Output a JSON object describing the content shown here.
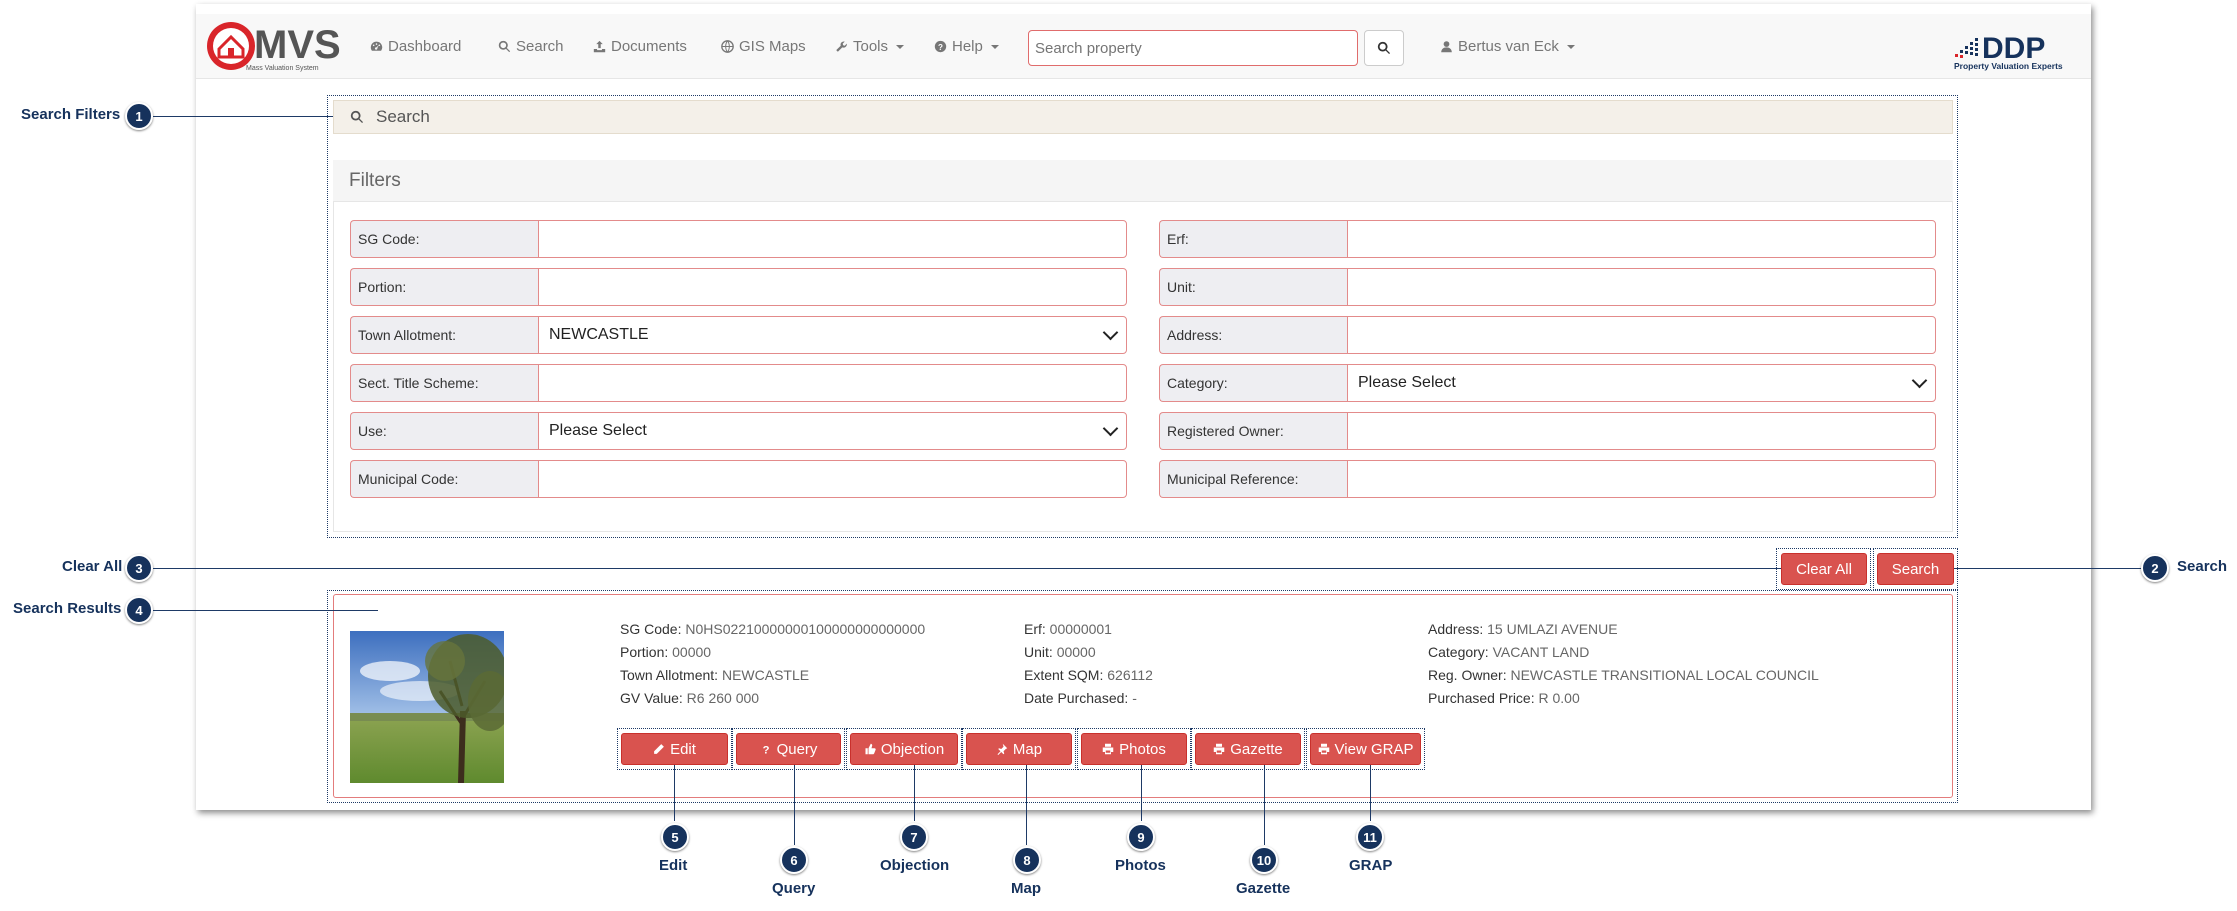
{
  "navbar": {
    "logo_text": "MVS",
    "logo_sub": "Mass Valuation System",
    "items": [
      {
        "label": "Dashboard",
        "icon": "dashboard-icon"
      },
      {
        "label": "Search",
        "icon": "search-icon"
      },
      {
        "label": "Documents",
        "icon": "upload-icon"
      },
      {
        "label": "GIS Maps",
        "icon": "globe-icon"
      },
      {
        "label": "Tools",
        "icon": "wrench-icon"
      },
      {
        "label": "Help",
        "icon": "question-icon"
      }
    ],
    "search_placeholder": "Search property",
    "user": "Bertus van Eck",
    "brand": "DDP",
    "brand_sub": "Property Valuation Experts"
  },
  "search_section": {
    "title": "Search"
  },
  "filters": {
    "title": "Filters",
    "left": [
      {
        "label": "SG Code:",
        "value": ""
      },
      {
        "label": "Portion:",
        "value": ""
      },
      {
        "label": "Town Allotment:",
        "value": "NEWCASTLE",
        "type": "select"
      },
      {
        "label": "Sect. Title Scheme:",
        "value": ""
      },
      {
        "label": "Use:",
        "value": "Please Select",
        "type": "select"
      },
      {
        "label": "Municipal Code:",
        "value": ""
      }
    ],
    "right": [
      {
        "label": "Erf:",
        "value": ""
      },
      {
        "label": "Unit:",
        "value": ""
      },
      {
        "label": "Address:",
        "value": ""
      },
      {
        "label": "Category:",
        "value": "Please Select",
        "type": "select"
      },
      {
        "label": "Registered Owner:",
        "value": ""
      },
      {
        "label": "Municipal Reference:",
        "value": ""
      }
    ]
  },
  "actions": {
    "clear_all": "Clear All",
    "search": "Search"
  },
  "result": {
    "col1": [
      {
        "k": "SG Code:",
        "v": "N0HS02210000000100000000000000"
      },
      {
        "k": "Portion:",
        "v": "00000"
      },
      {
        "k": "Town Allotment:",
        "v": "NEWCASTLE"
      },
      {
        "k": "GV Value:",
        "v": "R6 260 000"
      }
    ],
    "col2": [
      {
        "k": "Erf:",
        "v": "00000001"
      },
      {
        "k": "Unit:",
        "v": "00000"
      },
      {
        "k": "Extent SQM:",
        "v": "626112"
      },
      {
        "k": "Date Purchased:",
        "v": "-"
      }
    ],
    "col3": [
      {
        "k": "Address:",
        "v": "15 UMLAZI AVENUE"
      },
      {
        "k": "Category:",
        "v": "VACANT LAND"
      },
      {
        "k": "Reg. Owner:",
        "v": "NEWCASTLE TRANSITIONAL LOCAL COUNCIL"
      },
      {
        "k": "Purchased Price:",
        "v": "R 0.00"
      }
    ],
    "buttons": [
      {
        "label": "Edit",
        "icon": "pencil-icon"
      },
      {
        "label": "Query",
        "icon": "question-icon"
      },
      {
        "label": "Objection",
        "icon": "objection-icon"
      },
      {
        "label": "Map",
        "icon": "pin-icon"
      },
      {
        "label": "Photos",
        "icon": "print-icon"
      },
      {
        "label": "Gazette",
        "icon": "print-icon"
      },
      {
        "label": "View GRAP",
        "icon": "print-icon"
      }
    ]
  },
  "annotations": [
    {
      "num": "1",
      "label": "Search Filters"
    },
    {
      "num": "2",
      "label": "Search"
    },
    {
      "num": "3",
      "label": "Clear All"
    },
    {
      "num": "4",
      "label": "Search Results"
    },
    {
      "num": "5",
      "label": "Edit"
    },
    {
      "num": "6",
      "label": "Query"
    },
    {
      "num": "7",
      "label": "Objection"
    },
    {
      "num": "8",
      "label": "Map"
    },
    {
      "num": "9",
      "label": "Photos"
    },
    {
      "num": "10",
      "label": "Gazette"
    },
    {
      "num": "11",
      "label": "GRAP"
    }
  ],
  "colors": {
    "accent": "#d9534f",
    "annotation": "#16325c",
    "border_pink": "#e38b8b"
  }
}
